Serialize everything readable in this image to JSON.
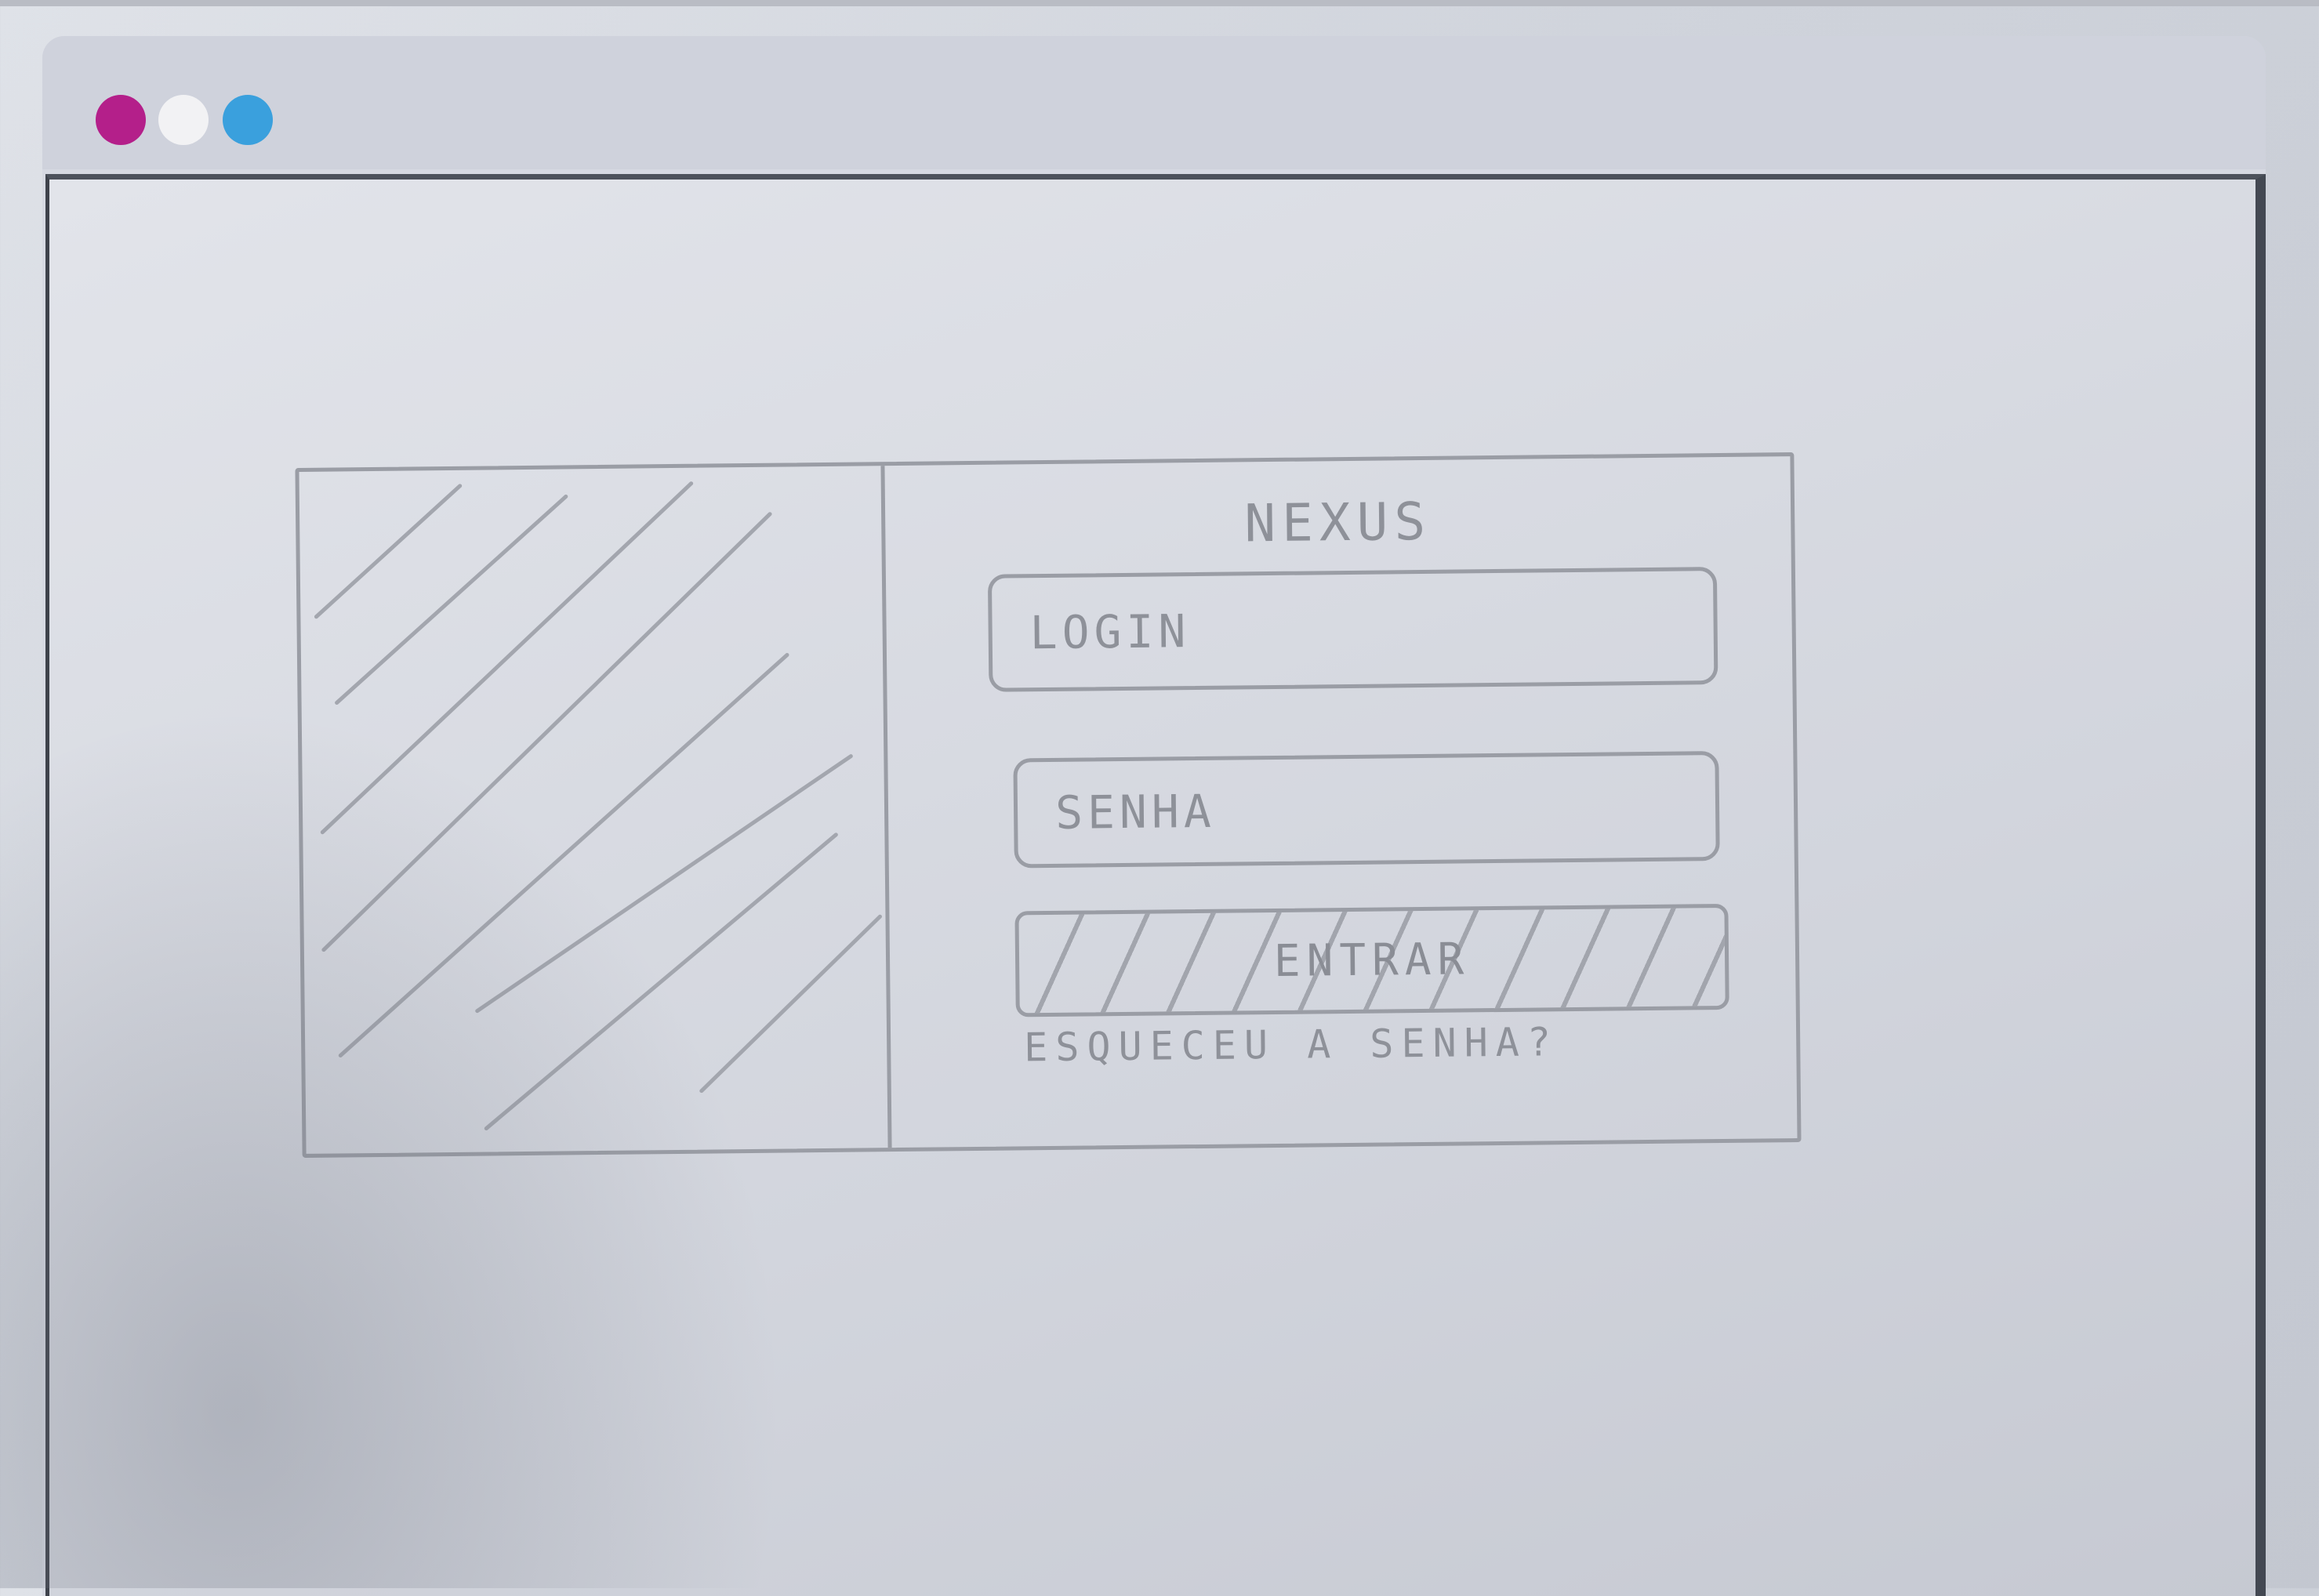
{
  "window": {
    "controls": [
      {
        "name": "close",
        "color": "#b41f8a"
      },
      {
        "name": "minimize",
        "color": "#f2f2f4"
      },
      {
        "name": "maximize",
        "color": "#3aa0dd"
      }
    ]
  },
  "login_card": {
    "brand": "NEXUS",
    "login_placeholder": "LOGIN",
    "password_placeholder": "SENHA",
    "enter_label": "ENTRAR",
    "forgot_link": "ESQUECEU A SENHA?"
  },
  "colors": {
    "pencil": "#9a9da5",
    "paper": "#d6d9e2"
  }
}
